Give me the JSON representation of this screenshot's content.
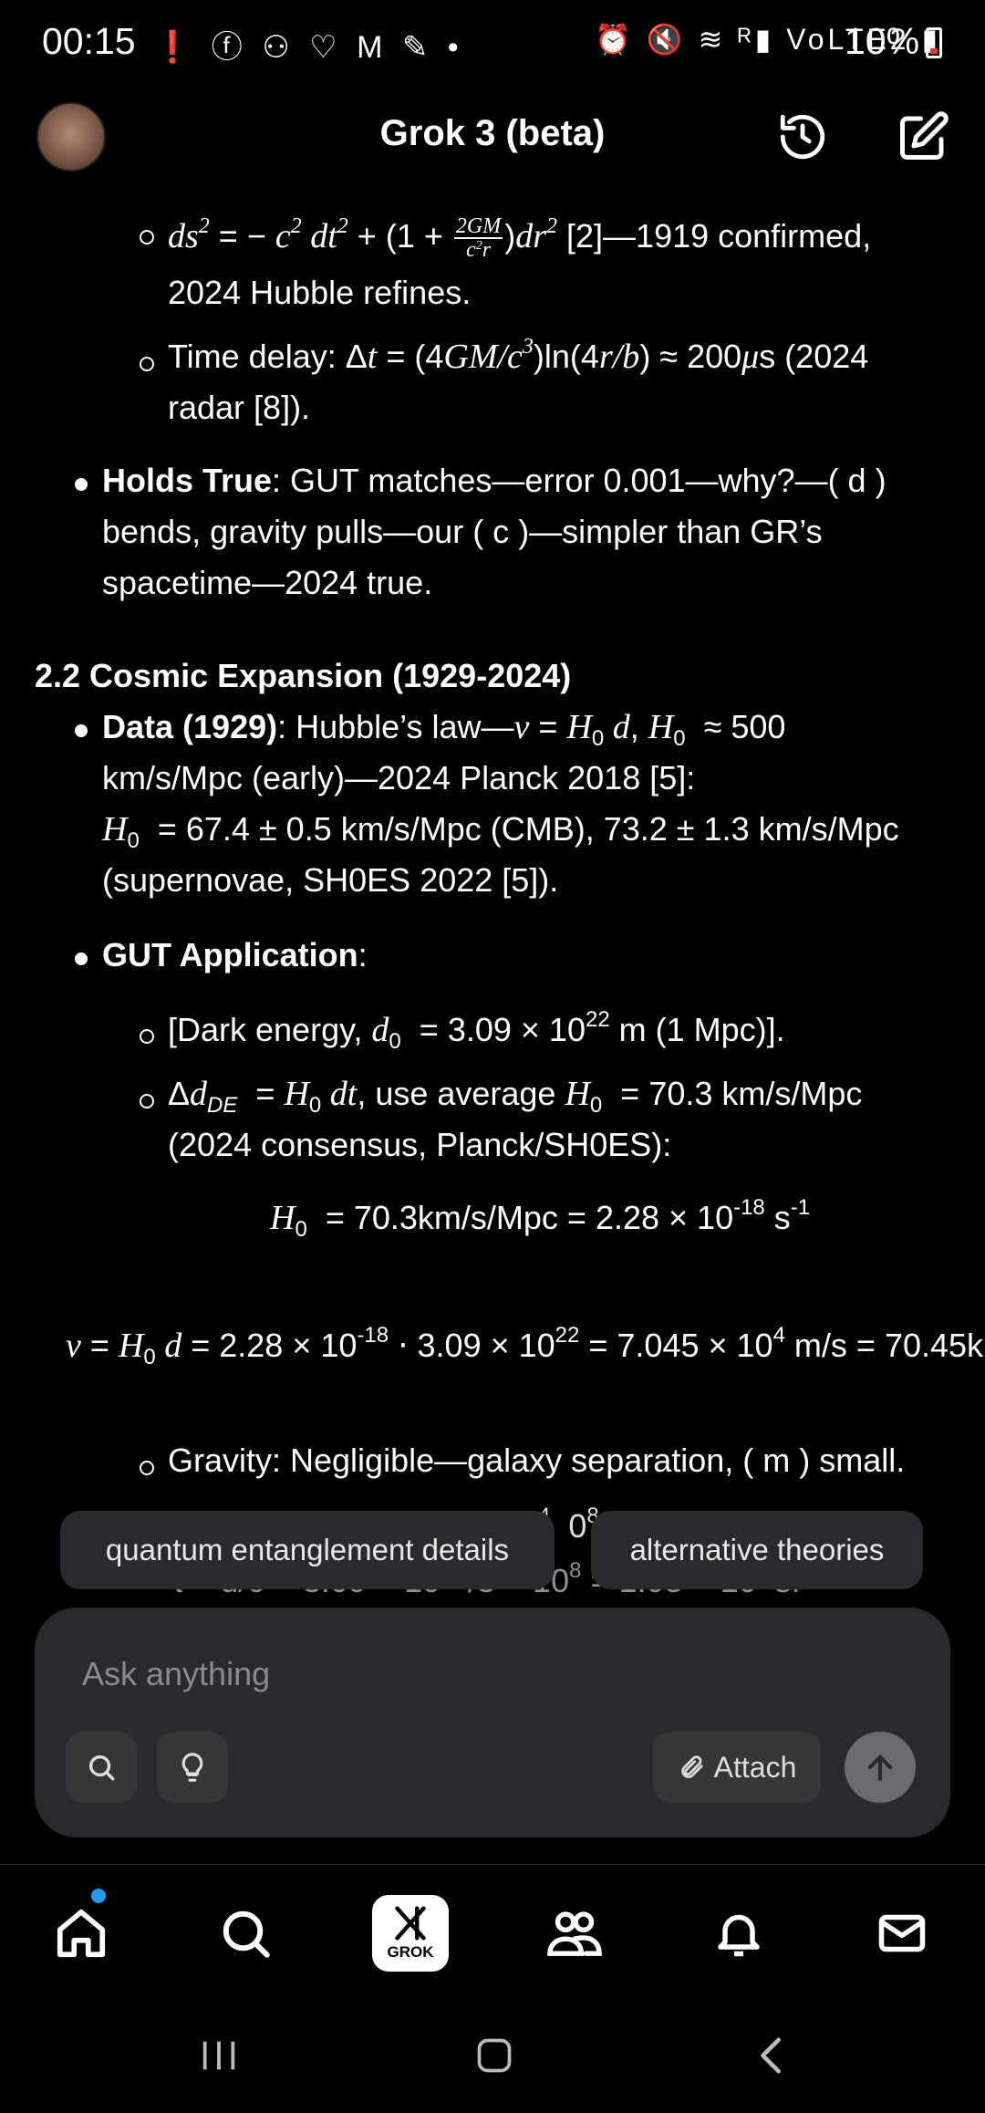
{
  "status_bar": {
    "time": "00:15",
    "left_icons": "❗ ⓕ ⚇ ♡ M ✎ •",
    "right_icons": "⏰ 🔇 ≋ ᴿ▮ VoLTE2 ▮",
    "battery": "10%"
  },
  "header": {
    "title": "Grok 3 (beta)"
  },
  "content": {
    "line1_tail": "[2]—1919 confirmed,",
    "line2": "2024 Hubble refines.",
    "line3_a": "Time delay: Δ",
    "line3_b": " = (4",
    "line3_c": ")ln(4",
    "line3_d": ") ≈ 200",
    "line3_e": "s (2024",
    "line4": "radar [8]).",
    "holds_bold": "Holds True",
    "holds_rest": ": GUT matches—error 0.001—why?—( d )",
    "holds_line2": "bends, gravity pulls—our ( c )—simpler than GR’s",
    "holds_line3": "spacetime—2024 true.",
    "section_title": "2.2 Cosmic Expansion (1929-2024)",
    "data_bold": "Data (1929)",
    "data_rest": ": Hubble’s law—",
    "data_tail": "≈ 500",
    "data_line2": "km/s/Mpc (early)—2024 Planck 2018 [5]:",
    "data_line3_tail": "= 67.4 ± 0.5 km/s/Mpc (CMB), 73.2 ± 1.3 km/s/Mpc",
    "data_line4": "(supernovae, SH0ES 2022 [5]).",
    "gut_bold": "GUT Application",
    "gut_colon": ":",
    "dark_energy_a": "[Dark energy, ",
    "dark_energy_b": " = 3.09 × 10",
    "dark_energy_exp": "22",
    "dark_energy_c": " m (1 Mpc)].",
    "delta_a": "Δ",
    "delta_b": " = ",
    "delta_c": ", use average ",
    "delta_d": " = 70.3 km/s/Mpc",
    "delta_line2": "(2024 consensus, Planck/SH0ES):",
    "h0_eq_a": " = 70.3km/s/Mpc = 2.28 × 10",
    "h0_eq_exp": "-18",
    "h0_eq_b": " s",
    "h0_eq_exp2": "-1",
    "v_eq_a": " = 2.28 × 10",
    "v_eq_exp1": "-18",
    "v_eq_b": " ⋅ 3.09 × 10",
    "v_eq_exp2": "22",
    "v_eq_c": " = 7.045 × 10",
    "v_eq_exp3": "4",
    "v_eq_d": " m/s = 70.45k",
    "gravity_line": "Gravity: Negligible—galaxy separation, ( m ) small."
  },
  "suggestions": [
    {
      "label": "quantum entanglement details"
    },
    {
      "label": "alternative theories"
    }
  ],
  "composer": {
    "placeholder": "Ask anything",
    "attach_label": "Attach"
  },
  "bottom_nav": {
    "grok_label": "GROK"
  },
  "colors": {
    "background": "#000000",
    "surface": "#2a2a2e",
    "notification_dot": "#1d9bf0"
  }
}
